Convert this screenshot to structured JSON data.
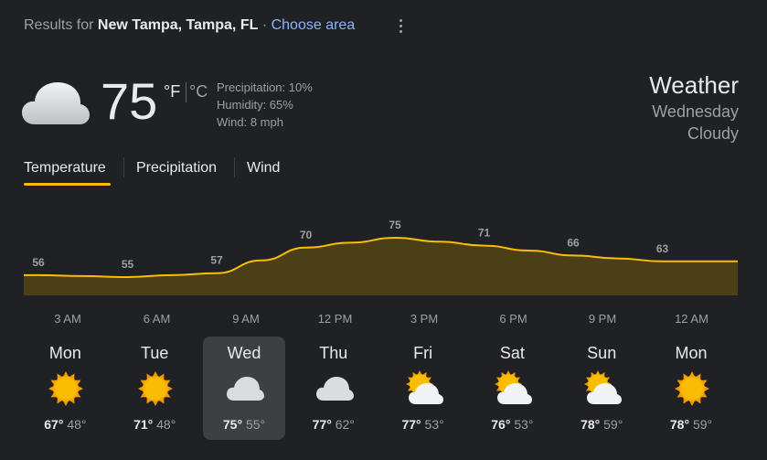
{
  "header": {
    "results_prefix": "Results for",
    "location": "New Tampa, Tampa, FL",
    "separator": "·",
    "choose_area": "Choose area",
    "more_icon": "more-vert-icon"
  },
  "current": {
    "icon": "cloudy-icon",
    "temperature": "75",
    "unit_f": "°F",
    "unit_c": "°C",
    "precipitation": "Precipitation: 10%",
    "humidity": "Humidity: 65%",
    "wind": "Wind: 8 mph",
    "title": "Weather",
    "day": "Wednesday",
    "condition": "Cloudy"
  },
  "tabs": [
    {
      "label": "Temperature",
      "selected": true
    },
    {
      "label": "Precipitation",
      "selected": false
    },
    {
      "label": "Wind",
      "selected": false
    }
  ],
  "colors": {
    "accent": "#fbbc04",
    "area_fill": "#4b4015",
    "line": "#fbbc04",
    "background": "#202124",
    "selected_day": "#3c4043"
  },
  "chart_data": {
    "type": "area",
    "x": [
      "3 AM",
      "6 AM",
      "9 AM",
      "12 PM",
      "3 PM",
      "6 PM",
      "9 PM",
      "12 AM"
    ],
    "values": [
      56,
      55,
      57,
      70,
      75,
      71,
      66,
      63
    ],
    "unit": "°F"
  },
  "days": [
    {
      "name": "Mon",
      "icon": "sunny-icon",
      "high": "67°",
      "low": "48°",
      "selected": false
    },
    {
      "name": "Tue",
      "icon": "sunny-icon",
      "high": "71°",
      "low": "48°",
      "selected": false
    },
    {
      "name": "Wed",
      "icon": "cloudy-icon",
      "high": "75°",
      "low": "55°",
      "selected": true
    },
    {
      "name": "Thu",
      "icon": "cloudy-icon",
      "high": "77°",
      "low": "62°",
      "selected": false
    },
    {
      "name": "Fri",
      "icon": "partly-cloudy-icon",
      "high": "77°",
      "low": "53°",
      "selected": false
    },
    {
      "name": "Sat",
      "icon": "partly-cloudy-icon",
      "high": "76°",
      "low": "53°",
      "selected": false
    },
    {
      "name": "Sun",
      "icon": "partly-cloudy-icon",
      "high": "78°",
      "low": "59°",
      "selected": false
    },
    {
      "name": "Mon",
      "icon": "sunny-icon",
      "high": "78°",
      "low": "59°",
      "selected": false
    }
  ]
}
